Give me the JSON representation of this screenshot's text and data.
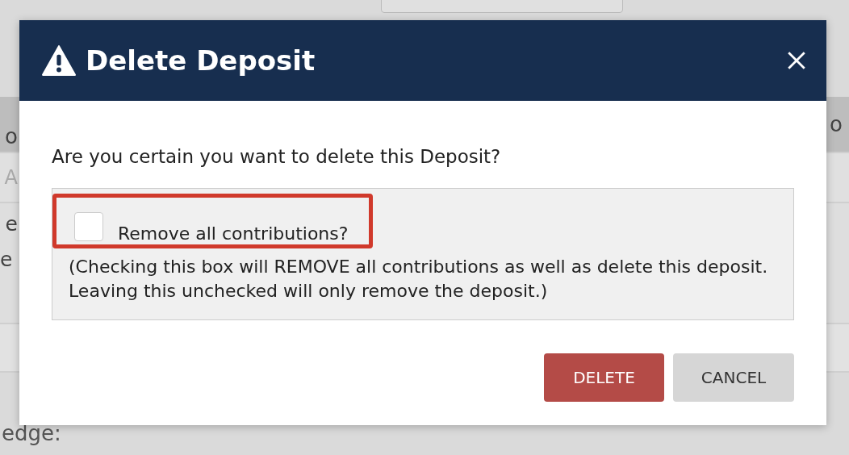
{
  "background": {
    "left_fragments": [
      "o",
      "A",
      "e",
      "e",
      "edge:"
    ],
    "right_fragments": [
      "o"
    ]
  },
  "dialog": {
    "title": "Delete Deposit",
    "question": "Are you certain you want to delete this Deposit?",
    "option": {
      "label": "Remove all contributions?",
      "checked": false,
      "highlighted": true,
      "note": "(Checking this box will REMOVE all contributions as well as delete this deposit. Leaving this unchecked will only remove the deposit.)"
    },
    "buttons": [
      {
        "label": "DELETE",
        "kind": "danger"
      },
      {
        "label": "CANCEL",
        "kind": "secondary"
      }
    ]
  }
}
